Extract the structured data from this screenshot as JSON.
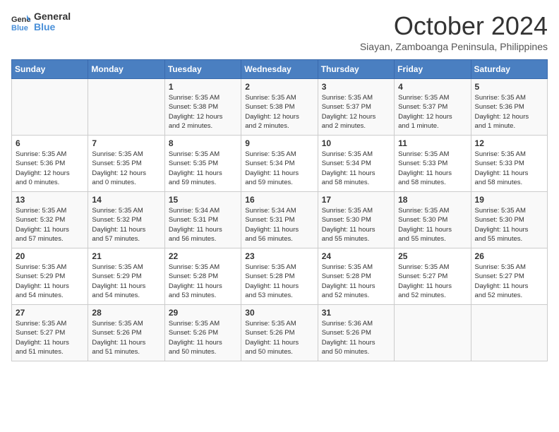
{
  "header": {
    "logo_line1": "General",
    "logo_line2": "Blue",
    "month": "October 2024",
    "location": "Siayan, Zamboanga Peninsula, Philippines"
  },
  "days_of_week": [
    "Sunday",
    "Monday",
    "Tuesday",
    "Wednesday",
    "Thursday",
    "Friday",
    "Saturday"
  ],
  "weeks": [
    [
      {
        "day": "",
        "info": ""
      },
      {
        "day": "",
        "info": ""
      },
      {
        "day": "1",
        "info": "Sunrise: 5:35 AM\nSunset: 5:38 PM\nDaylight: 12 hours\nand 2 minutes."
      },
      {
        "day": "2",
        "info": "Sunrise: 5:35 AM\nSunset: 5:38 PM\nDaylight: 12 hours\nand 2 minutes."
      },
      {
        "day": "3",
        "info": "Sunrise: 5:35 AM\nSunset: 5:37 PM\nDaylight: 12 hours\nand 2 minutes."
      },
      {
        "day": "4",
        "info": "Sunrise: 5:35 AM\nSunset: 5:37 PM\nDaylight: 12 hours\nand 1 minute."
      },
      {
        "day": "5",
        "info": "Sunrise: 5:35 AM\nSunset: 5:36 PM\nDaylight: 12 hours\nand 1 minute."
      }
    ],
    [
      {
        "day": "6",
        "info": "Sunrise: 5:35 AM\nSunset: 5:36 PM\nDaylight: 12 hours\nand 0 minutes."
      },
      {
        "day": "7",
        "info": "Sunrise: 5:35 AM\nSunset: 5:35 PM\nDaylight: 12 hours\nand 0 minutes."
      },
      {
        "day": "8",
        "info": "Sunrise: 5:35 AM\nSunset: 5:35 PM\nDaylight: 11 hours\nand 59 minutes."
      },
      {
        "day": "9",
        "info": "Sunrise: 5:35 AM\nSunset: 5:34 PM\nDaylight: 11 hours\nand 59 minutes."
      },
      {
        "day": "10",
        "info": "Sunrise: 5:35 AM\nSunset: 5:34 PM\nDaylight: 11 hours\nand 58 minutes."
      },
      {
        "day": "11",
        "info": "Sunrise: 5:35 AM\nSunset: 5:33 PM\nDaylight: 11 hours\nand 58 minutes."
      },
      {
        "day": "12",
        "info": "Sunrise: 5:35 AM\nSunset: 5:33 PM\nDaylight: 11 hours\nand 58 minutes."
      }
    ],
    [
      {
        "day": "13",
        "info": "Sunrise: 5:35 AM\nSunset: 5:32 PM\nDaylight: 11 hours\nand 57 minutes."
      },
      {
        "day": "14",
        "info": "Sunrise: 5:35 AM\nSunset: 5:32 PM\nDaylight: 11 hours\nand 57 minutes."
      },
      {
        "day": "15",
        "info": "Sunrise: 5:34 AM\nSunset: 5:31 PM\nDaylight: 11 hours\nand 56 minutes."
      },
      {
        "day": "16",
        "info": "Sunrise: 5:34 AM\nSunset: 5:31 PM\nDaylight: 11 hours\nand 56 minutes."
      },
      {
        "day": "17",
        "info": "Sunrise: 5:35 AM\nSunset: 5:30 PM\nDaylight: 11 hours\nand 55 minutes."
      },
      {
        "day": "18",
        "info": "Sunrise: 5:35 AM\nSunset: 5:30 PM\nDaylight: 11 hours\nand 55 minutes."
      },
      {
        "day": "19",
        "info": "Sunrise: 5:35 AM\nSunset: 5:30 PM\nDaylight: 11 hours\nand 55 minutes."
      }
    ],
    [
      {
        "day": "20",
        "info": "Sunrise: 5:35 AM\nSunset: 5:29 PM\nDaylight: 11 hours\nand 54 minutes."
      },
      {
        "day": "21",
        "info": "Sunrise: 5:35 AM\nSunset: 5:29 PM\nDaylight: 11 hours\nand 54 minutes."
      },
      {
        "day": "22",
        "info": "Sunrise: 5:35 AM\nSunset: 5:28 PM\nDaylight: 11 hours\nand 53 minutes."
      },
      {
        "day": "23",
        "info": "Sunrise: 5:35 AM\nSunset: 5:28 PM\nDaylight: 11 hours\nand 53 minutes."
      },
      {
        "day": "24",
        "info": "Sunrise: 5:35 AM\nSunset: 5:28 PM\nDaylight: 11 hours\nand 52 minutes."
      },
      {
        "day": "25",
        "info": "Sunrise: 5:35 AM\nSunset: 5:27 PM\nDaylight: 11 hours\nand 52 minutes."
      },
      {
        "day": "26",
        "info": "Sunrise: 5:35 AM\nSunset: 5:27 PM\nDaylight: 11 hours\nand 52 minutes."
      }
    ],
    [
      {
        "day": "27",
        "info": "Sunrise: 5:35 AM\nSunset: 5:27 PM\nDaylight: 11 hours\nand 51 minutes."
      },
      {
        "day": "28",
        "info": "Sunrise: 5:35 AM\nSunset: 5:26 PM\nDaylight: 11 hours\nand 51 minutes."
      },
      {
        "day": "29",
        "info": "Sunrise: 5:35 AM\nSunset: 5:26 PM\nDaylight: 11 hours\nand 50 minutes."
      },
      {
        "day": "30",
        "info": "Sunrise: 5:35 AM\nSunset: 5:26 PM\nDaylight: 11 hours\nand 50 minutes."
      },
      {
        "day": "31",
        "info": "Sunrise: 5:36 AM\nSunset: 5:26 PM\nDaylight: 11 hours\nand 50 minutes."
      },
      {
        "day": "",
        "info": ""
      },
      {
        "day": "",
        "info": ""
      }
    ]
  ]
}
